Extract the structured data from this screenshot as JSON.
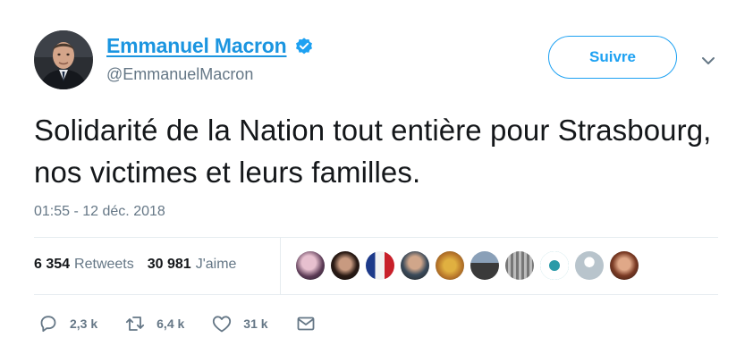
{
  "tweet": {
    "author": {
      "display_name": "Emmanuel Macron",
      "handle": "@EmmanuelMacron",
      "verified": true
    },
    "follow_label": "Suivre",
    "text": "Solidarité de la Nation tout entière pour Strasbourg, nos victimes et leurs familles.",
    "timestamp": "01:55 - 12 déc. 2018",
    "stats": {
      "retweets_count": "6 354",
      "retweets_label": "Retweets",
      "likes_count": "30 981",
      "likes_label": "J'aime"
    },
    "actions": {
      "reply_count": "2,3 k",
      "retweet_count": "6,4 k",
      "like_count": "31 k"
    }
  },
  "colors": {
    "accent": "#1da1f2",
    "name_blue": "#1b95e0",
    "muted": "#657786",
    "text": "#14171a",
    "divider": "#e6ecf0"
  },
  "icons": [
    "verified-badge-icon",
    "chevron-down-icon",
    "reply-icon",
    "retweet-icon",
    "like-icon",
    "direct-message-icon"
  ]
}
